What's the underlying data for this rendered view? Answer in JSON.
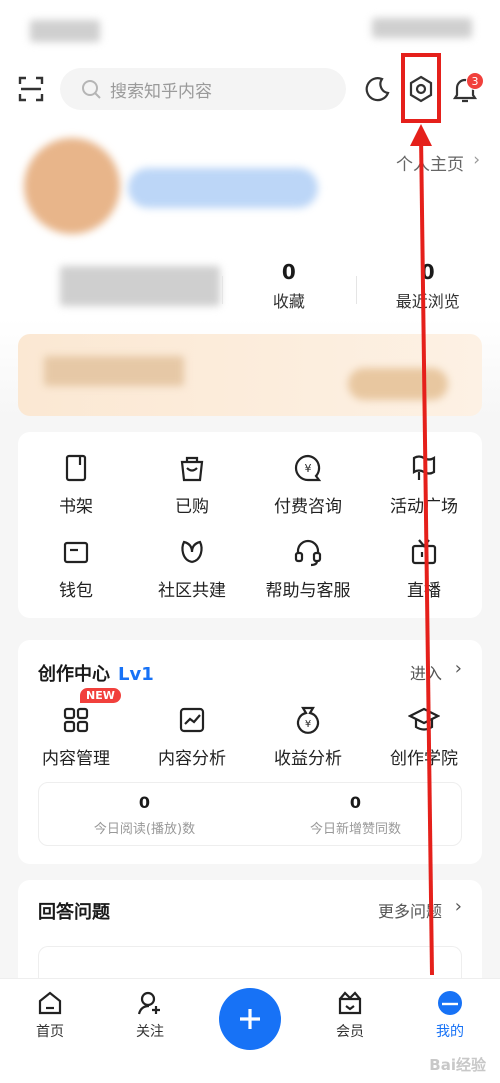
{
  "search": {
    "placeholder": "搜索知乎内容"
  },
  "notifications": {
    "badge_count": "3"
  },
  "profile": {
    "homepage_link": "个人主页",
    "stats": [
      {
        "value": "0",
        "label": "收藏"
      },
      {
        "value": "0",
        "label": "最近浏览"
      }
    ]
  },
  "services": [
    {
      "label": "书架",
      "icon": "bookshelf-icon"
    },
    {
      "label": "已购",
      "icon": "shopping-bag-icon"
    },
    {
      "label": "付费咨询",
      "icon": "paid-consult-icon"
    },
    {
      "label": "活动广场",
      "icon": "flag-icon"
    },
    {
      "label": "钱包",
      "icon": "wallet-icon"
    },
    {
      "label": "社区共建",
      "icon": "community-icon"
    },
    {
      "label": "帮助与客服",
      "icon": "headset-icon"
    },
    {
      "label": "直播",
      "icon": "live-tv-icon"
    }
  ],
  "creation": {
    "title": "创作中心",
    "level": "Lv1",
    "enter": "进入",
    "new_badge": "NEW",
    "items": [
      {
        "label": "内容管理",
        "icon": "content-manage-icon"
      },
      {
        "label": "内容分析",
        "icon": "content-analysis-icon"
      },
      {
        "label": "收益分析",
        "icon": "money-bag-icon"
      },
      {
        "label": "创作学院",
        "icon": "graduation-cap-icon"
      }
    ],
    "today": [
      {
        "value": "0",
        "label": "今日阅读(播放)数"
      },
      {
        "value": "0",
        "label": "今日新增赞同数"
      }
    ]
  },
  "answers": {
    "title": "回答问题",
    "more": "更多问题"
  },
  "tabbar": [
    {
      "label": "首页",
      "icon": "home-icon"
    },
    {
      "label": "关注",
      "icon": "follow-icon"
    },
    {
      "label": "会员",
      "icon": "member-icon"
    },
    {
      "label": "我的",
      "icon": "profile-icon"
    }
  ],
  "watermark": "Bai经验",
  "colors": {
    "accent": "#1772f6",
    "badge": "#f1403c",
    "annotation": "#e5201b"
  }
}
